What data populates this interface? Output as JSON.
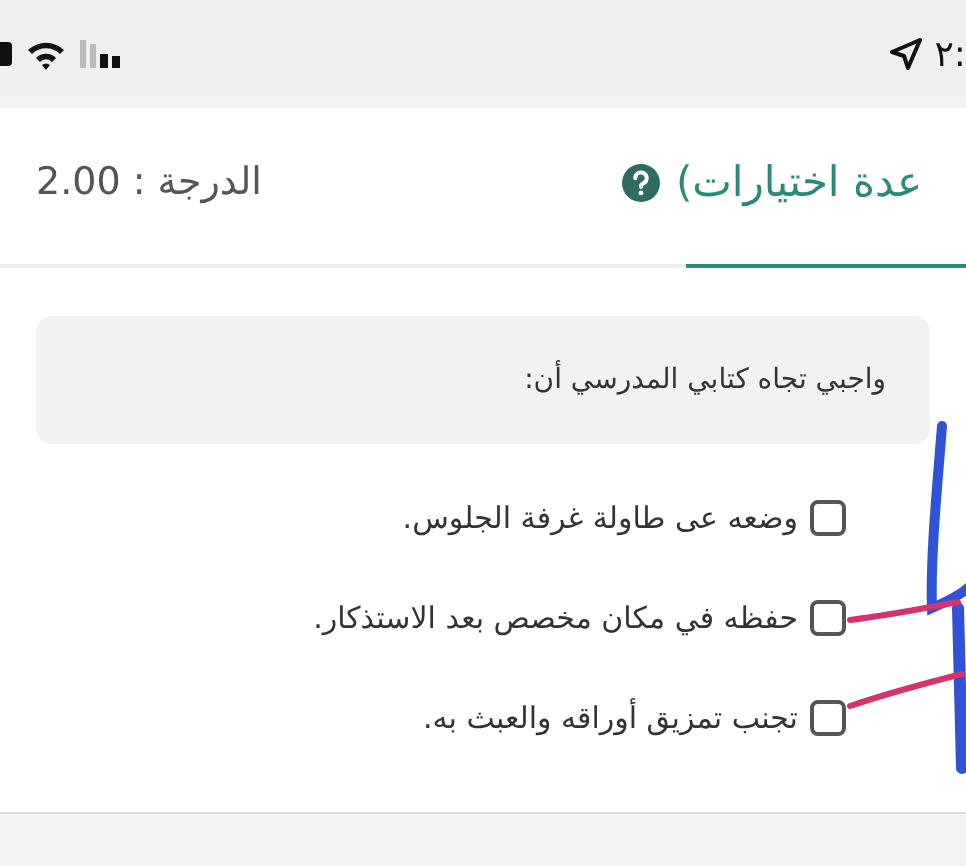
{
  "status_bar": {
    "time": "٢:"
  },
  "header": {
    "title": "عدة اختيارات)",
    "score": "الدرجة : 2.00"
  },
  "question": {
    "text": "واجبي تجاه كتابي المدرسي أن:"
  },
  "options": [
    {
      "label": "وضعه عى طاولة غرفة الجلوس.",
      "checked": false
    },
    {
      "label": "حفظه في مكان مخصص بعد الاستذكار.",
      "checked": false
    },
    {
      "label": "تجنب تمزيق أوراقه والعبث به.",
      "checked": false
    }
  ]
}
